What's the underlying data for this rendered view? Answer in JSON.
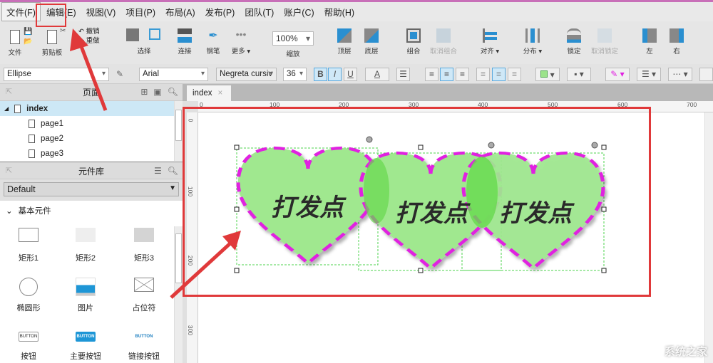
{
  "menubar": {
    "items": [
      "文件(F)",
      "编辑(E)",
      "视图(V)",
      "项目(P)",
      "布局(A)",
      "发布(P)",
      "团队(T)",
      "账户(C)",
      "帮助(H)"
    ]
  },
  "toolbar": {
    "file": "文件",
    "clipboard": "剪贴板",
    "undo": "撤销",
    "redo": "重做",
    "select": "选择",
    "connect": "连接",
    "pen": "钢笔",
    "more": "更多 ▾",
    "zoom_value": "100%",
    "zoom_label": "缩放",
    "front": "顶层",
    "back": "底层",
    "group": "组合",
    "ungroup": "取消组合",
    "align": "对齐 ▾",
    "distribute": "分布 ▾",
    "lock": "锁定",
    "unlock": "取消锁定",
    "left": "左",
    "right": "右"
  },
  "format": {
    "shape_type": "Ellipse",
    "font": "Arial",
    "font_style": "Negreta cursiv",
    "font_size": "36",
    "bold": "B",
    "italic": "I",
    "underline": "U",
    "text_color_glyph": "A",
    "fill_color": "#9be38a",
    "line_color": "#e020e0"
  },
  "pages_panel": {
    "title": "页面",
    "pages": [
      {
        "name": "index",
        "active": true
      },
      {
        "name": "page1"
      },
      {
        "name": "page2"
      },
      {
        "name": "page3"
      }
    ]
  },
  "widgets_panel": {
    "title": "元件库",
    "library": "Default",
    "section": "基本元件",
    "widgets": [
      {
        "label": "矩形1",
        "icon": "rectangle-icon"
      },
      {
        "label": "矩形2",
        "icon": "rectangle-light-icon"
      },
      {
        "label": "矩形3",
        "icon": "rectangle-gray-icon"
      },
      {
        "label": "椭圆形",
        "icon": "ellipse-icon"
      },
      {
        "label": "图片",
        "icon": "image-icon"
      },
      {
        "label": "占位符",
        "icon": "placeholder-icon"
      },
      {
        "label": "按钮",
        "icon": "button-icon",
        "text": "BUTTON"
      },
      {
        "label": "主要按钮",
        "icon": "primary-button-icon",
        "text": "BUTTON"
      },
      {
        "label": "链接按钮",
        "icon": "link-button-icon",
        "text": "BUTTON"
      }
    ]
  },
  "editor": {
    "tab": "index",
    "ruler_h": [
      "0",
      "100",
      "200",
      "300",
      "400",
      "500",
      "600",
      "700"
    ],
    "ruler_v": [
      "0",
      "100",
      "200",
      "300"
    ]
  },
  "canvas": {
    "hearts": [
      {
        "text": "打发点"
      },
      {
        "text": "打发点"
      },
      {
        "text": "打发点"
      }
    ],
    "heart_fill": "#a0e88f",
    "overlap_fill": "#66d94d",
    "stroke": "#e020e0"
  },
  "watermark": "系统之家",
  "annotation_color": "#e0393a"
}
